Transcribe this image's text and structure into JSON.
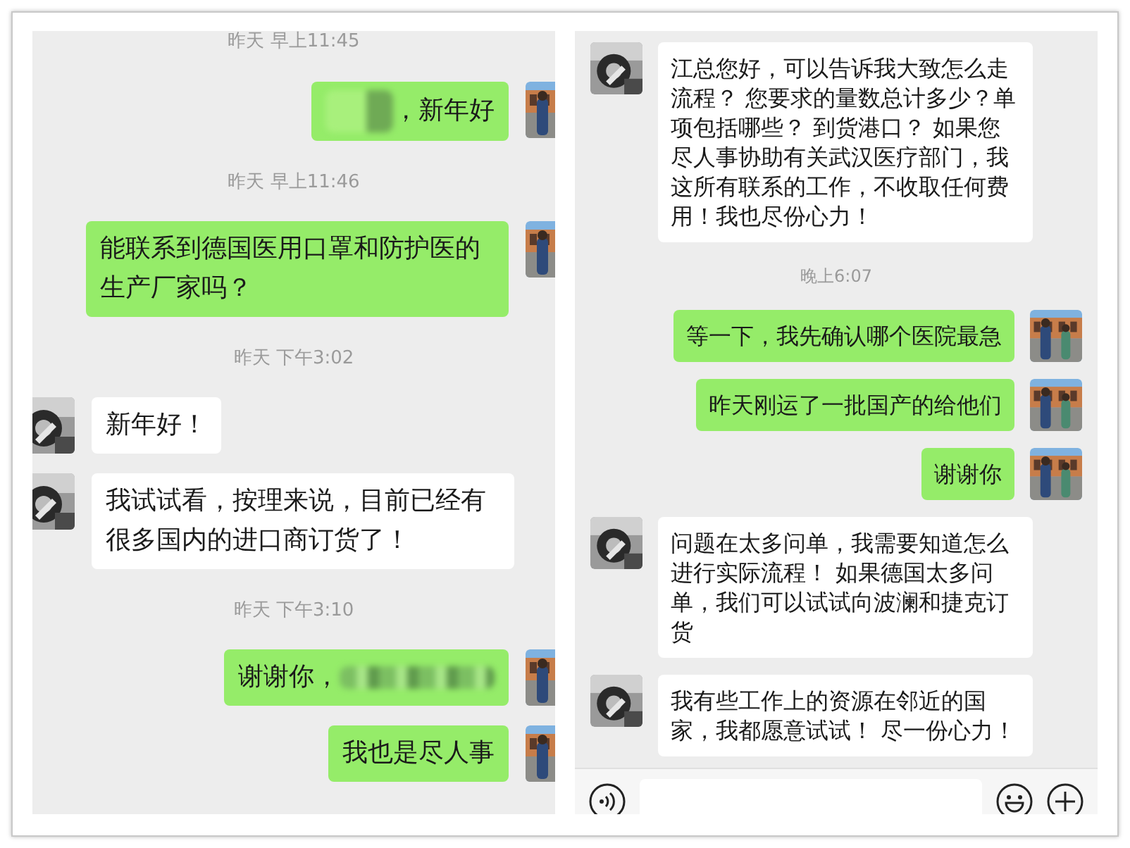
{
  "panels": [
    {
      "messages": [
        {
          "kind": "time",
          "text": "昨天 早上11:45"
        },
        {
          "kind": "sent",
          "text": "，新年好",
          "redacted_start": true
        },
        {
          "kind": "time",
          "text": "昨天 早上11:46"
        },
        {
          "kind": "sent",
          "text": "能联系到德国医用口罩和防护医的生产厂家吗？"
        },
        {
          "kind": "time",
          "text": "昨天 下午3:02"
        },
        {
          "kind": "received",
          "text": "新年好！"
        },
        {
          "kind": "received",
          "text": "我试试看，按理来说，目前已经有很多国内的进口商订货了！"
        },
        {
          "kind": "time",
          "text": "昨天 下午3:10"
        },
        {
          "kind": "sent",
          "text": "谢谢你，",
          "redacted_end": true
        },
        {
          "kind": "sent",
          "text": "我也是尽人事"
        }
      ]
    },
    {
      "input_bar": true,
      "messages": [
        {
          "kind": "received",
          "text": "江总您好，可以告诉我大致怎么走流程？ 您要求的量数总计多少？单项包括哪些？ 到货港口？ 如果您尽人事协助有关武汉医疗部门，我这所有联系的工作，不收取任何费用！我也尽份心力！"
        },
        {
          "kind": "time",
          "text": "晚上6:07"
        },
        {
          "kind": "sent",
          "text": "等一下，我先确认哪个医院最急"
        },
        {
          "kind": "sent",
          "text": "昨天刚运了一批国产的给他们"
        },
        {
          "kind": "sent",
          "text": "谢谢你"
        },
        {
          "kind": "received",
          "text": "问题在太多问单，我需要知道怎么进行实际流程！ 如果德国太多问单，我们可以试试向波澜和捷克订货"
        },
        {
          "kind": "received",
          "text": "我有些工作上的资源在邻近的国家，我都愿意试试！ 尽一份心力！"
        }
      ]
    }
  ]
}
